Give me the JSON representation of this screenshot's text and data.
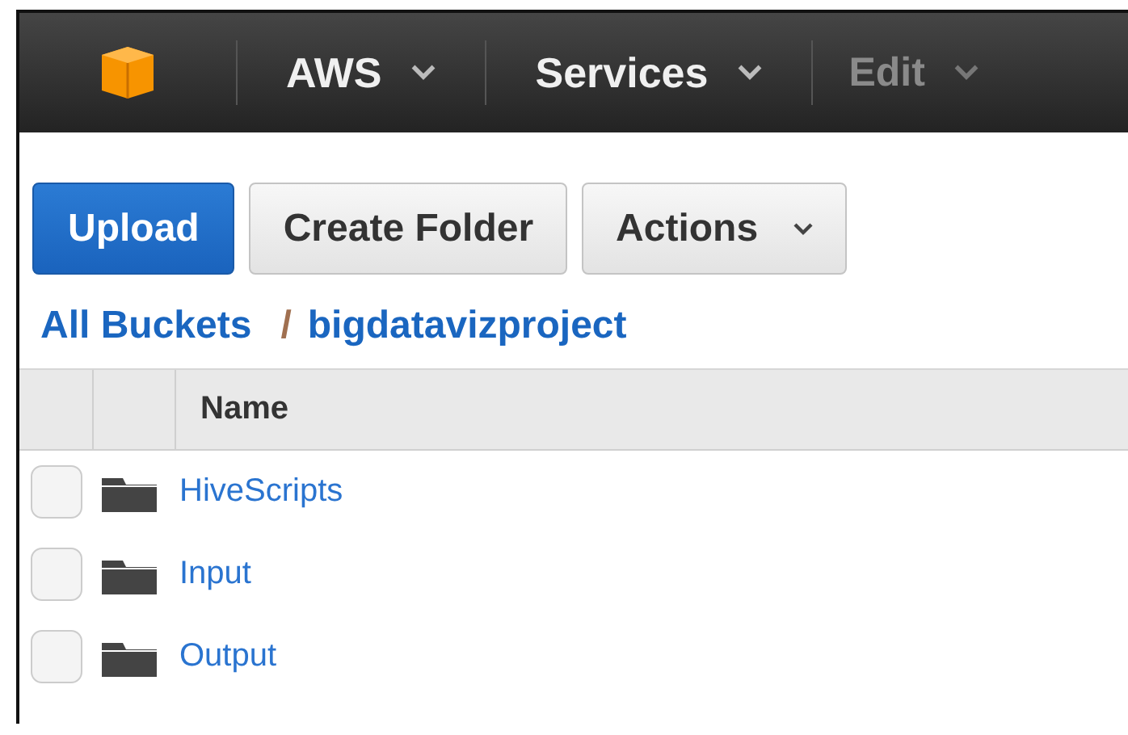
{
  "nav": {
    "items": [
      {
        "label": "AWS",
        "disabled": false
      },
      {
        "label": "Services",
        "disabled": false
      },
      {
        "label": "Edit",
        "disabled": true
      }
    ]
  },
  "toolbar": {
    "buttons": [
      {
        "label": "Upload",
        "kind": "primary"
      },
      {
        "label": "Create Folder",
        "kind": "plain"
      },
      {
        "label": "Actions",
        "kind": "dropdown"
      }
    ]
  },
  "breadcrumb": {
    "items": [
      "All Buckets",
      "bigdatavizproject"
    ],
    "separator": "/"
  },
  "table": {
    "columns": [
      "Name"
    ],
    "rows": [
      {
        "name": "HiveScripts",
        "checked": false
      },
      {
        "name": "Input",
        "checked": false
      },
      {
        "name": "Output",
        "checked": false
      }
    ]
  }
}
